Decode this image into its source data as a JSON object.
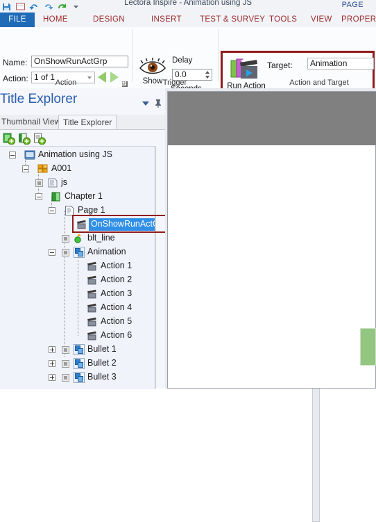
{
  "window": {
    "title": "Lectora Inspire - Animation using JS",
    "contextual_tab_group": "PAGE",
    "quick_access": [
      "save-icon",
      "window-icon",
      "undo-icon",
      "redo-icon",
      "publish-icon",
      "customize-caret-icon"
    ]
  },
  "ribbon": {
    "tabs": [
      {
        "key": "file",
        "label": "FILE"
      },
      {
        "key": "home",
        "label": "HOME"
      },
      {
        "key": "design",
        "label": "DESIGN"
      },
      {
        "key": "insert",
        "label": "INSERT"
      },
      {
        "key": "test",
        "label": "TEST & SURVEY"
      },
      {
        "key": "tools",
        "label": "TOOLS"
      },
      {
        "key": "view",
        "label": "VIEW"
      },
      {
        "key": "properties",
        "label": "PROPERTIES"
      }
    ],
    "groups": {
      "action": {
        "label": "Action",
        "name_label": "Name:",
        "name_value": "OnShowRunActGrp",
        "action_label": "Action:",
        "action_value": "1 of 1",
        "prev_icon": "previous-action-arrow-icon",
        "next_icon": "next-action-arrow-icon",
        "dialog_launcher_icon": "dialog-launcher-icon"
      },
      "trigger": {
        "label": "Trigger",
        "show_label": "Show",
        "show_icon": "eye-icon",
        "delay_label": "Delay",
        "delay_value": "0.0",
        "seconds_label": "Seconds",
        "spinner_icon": "spinner-updown-icon"
      },
      "action_and_target": {
        "label": "Action and Target",
        "run_action_label": "Run Action Group",
        "run_action_icon": "run-action-group-icon",
        "target_label": "Target:",
        "target_value": "Animation",
        "highlight_color": "#8e1b1b"
      }
    }
  },
  "left_panel": {
    "title": "Title Explorer",
    "caret_icon": "chevron-down-icon",
    "pin_icon": "pin-icon",
    "tabs": [
      {
        "key": "thumbnail",
        "label": "Thumbnail View",
        "active": false
      },
      {
        "key": "explorer",
        "label": "Title Explorer",
        "active": true
      }
    ],
    "toolbar_icons": [
      "add-chapter-icon",
      "add-section-icon",
      "add-page-icon"
    ],
    "tree": [
      {
        "label": "Animation using JS",
        "indent": 0,
        "icon": "title-icon",
        "expander": "minus",
        "checkbox": false
      },
      {
        "label": "A001",
        "indent": 1,
        "icon": "group-icon",
        "expander": "minus",
        "checkbox": false
      },
      {
        "label": "js",
        "indent": 2,
        "icon": "html-object-icon",
        "expander": "none",
        "checkbox": true
      },
      {
        "label": "Chapter 1",
        "indent": 2,
        "icon": "chapter-icon",
        "expander": "minus",
        "checkbox": false
      },
      {
        "label": "Page 1",
        "indent": 3,
        "icon": "page-icon",
        "expander": "minus",
        "checkbox": false
      },
      {
        "label": "OnShowRunActGrp",
        "indent": 4,
        "icon": "action-icon",
        "expander": "none",
        "checkbox": false,
        "selected": true
      },
      {
        "label": "blt_line",
        "indent": 4,
        "icon": "shape-icon",
        "expander": "none",
        "checkbox": true
      },
      {
        "label": "Animation",
        "indent": 4,
        "icon": "action-group-icon",
        "expander": "minus",
        "checkbox": true
      },
      {
        "label": "Action 1",
        "indent": 5,
        "icon": "action-icon",
        "expander": "none",
        "checkbox": false
      },
      {
        "label": "Action 2",
        "indent": 5,
        "icon": "action-icon",
        "expander": "none",
        "checkbox": false
      },
      {
        "label": "Action 3",
        "indent": 5,
        "icon": "action-icon",
        "expander": "none",
        "checkbox": false
      },
      {
        "label": "Action 4",
        "indent": 5,
        "icon": "action-icon",
        "expander": "none",
        "checkbox": false
      },
      {
        "label": "Action 5",
        "indent": 5,
        "icon": "action-icon",
        "expander": "none",
        "checkbox": false
      },
      {
        "label": "Action 6",
        "indent": 5,
        "icon": "action-icon",
        "expander": "none",
        "checkbox": false
      },
      {
        "label": "Bullet 1",
        "indent": 4,
        "icon": "action-group-icon",
        "expander": "plus",
        "checkbox": true
      },
      {
        "label": "Bullet 2",
        "indent": 4,
        "icon": "action-group-icon",
        "expander": "plus",
        "checkbox": true
      },
      {
        "label": "Bullet 3",
        "indent": 4,
        "icon": "action-group-icon",
        "expander": "plus",
        "checkbox": true
      }
    ],
    "selection_highlight_color": "#2f8fe8",
    "selection_box_color": "#8e1b1b"
  },
  "canvas": {
    "top_band_color": "#808080",
    "page_color": "#ffffff",
    "objects": [
      {
        "name": "green-rectangle",
        "color": "#93c680"
      }
    ]
  }
}
